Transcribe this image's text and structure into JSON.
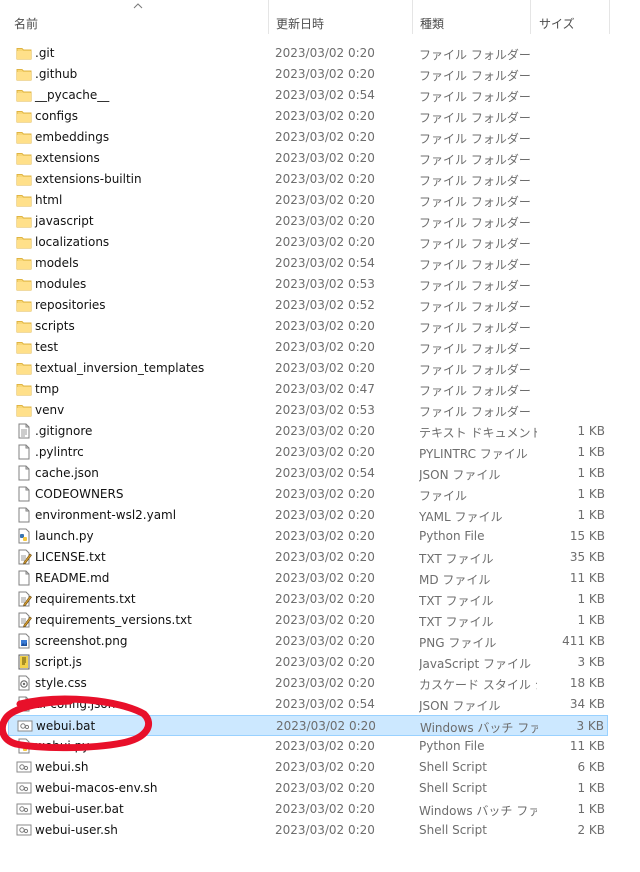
{
  "header": {
    "name": "名前",
    "modified": "更新日時",
    "type": "種類",
    "size": "サイズ"
  },
  "rows": [
    {
      "name": ".git",
      "date": "2023/03/02 0:20",
      "type": "ファイル フォルダー",
      "size": "",
      "icon": "folder-icon"
    },
    {
      "name": ".github",
      "date": "2023/03/02 0:20",
      "type": "ファイル フォルダー",
      "size": "",
      "icon": "folder-icon"
    },
    {
      "name": "__pycache__",
      "date": "2023/03/02 0:54",
      "type": "ファイル フォルダー",
      "size": "",
      "icon": "folder-icon"
    },
    {
      "name": "configs",
      "date": "2023/03/02 0:20",
      "type": "ファイル フォルダー",
      "size": "",
      "icon": "folder-icon"
    },
    {
      "name": "embeddings",
      "date": "2023/03/02 0:20",
      "type": "ファイル フォルダー",
      "size": "",
      "icon": "folder-icon"
    },
    {
      "name": "extensions",
      "date": "2023/03/02 0:20",
      "type": "ファイル フォルダー",
      "size": "",
      "icon": "folder-icon"
    },
    {
      "name": "extensions-builtin",
      "date": "2023/03/02 0:20",
      "type": "ファイル フォルダー",
      "size": "",
      "icon": "folder-icon"
    },
    {
      "name": "html",
      "date": "2023/03/02 0:20",
      "type": "ファイル フォルダー",
      "size": "",
      "icon": "folder-icon"
    },
    {
      "name": "javascript",
      "date": "2023/03/02 0:20",
      "type": "ファイル フォルダー",
      "size": "",
      "icon": "folder-icon"
    },
    {
      "name": "localizations",
      "date": "2023/03/02 0:20",
      "type": "ファイル フォルダー",
      "size": "",
      "icon": "folder-icon"
    },
    {
      "name": "models",
      "date": "2023/03/02 0:54",
      "type": "ファイル フォルダー",
      "size": "",
      "icon": "folder-icon"
    },
    {
      "name": "modules",
      "date": "2023/03/02 0:53",
      "type": "ファイル フォルダー",
      "size": "",
      "icon": "folder-icon"
    },
    {
      "name": "repositories",
      "date": "2023/03/02 0:52",
      "type": "ファイル フォルダー",
      "size": "",
      "icon": "folder-icon"
    },
    {
      "name": "scripts",
      "date": "2023/03/02 0:20",
      "type": "ファイル フォルダー",
      "size": "",
      "icon": "folder-icon"
    },
    {
      "name": "test",
      "date": "2023/03/02 0:20",
      "type": "ファイル フォルダー",
      "size": "",
      "icon": "folder-icon"
    },
    {
      "name": "textual_inversion_templates",
      "date": "2023/03/02 0:20",
      "type": "ファイル フォルダー",
      "size": "",
      "icon": "folder-icon"
    },
    {
      "name": "tmp",
      "date": "2023/03/02 0:47",
      "type": "ファイル フォルダー",
      "size": "",
      "icon": "folder-icon"
    },
    {
      "name": "venv",
      "date": "2023/03/02 0:53",
      "type": "ファイル フォルダー",
      "size": "",
      "icon": "folder-icon"
    },
    {
      "name": ".gitignore",
      "date": "2023/03/02 0:20",
      "type": "テキスト ドキュメント",
      "size": "1 KB",
      "icon": "text-document-icon"
    },
    {
      "name": ".pylintrc",
      "date": "2023/03/02 0:20",
      "type": "PYLINTRC ファイル",
      "size": "1 KB",
      "icon": "blank-file-icon"
    },
    {
      "name": "cache.json",
      "date": "2023/03/02 0:54",
      "type": "JSON ファイル",
      "size": "1 KB",
      "icon": "blank-file-icon"
    },
    {
      "name": "CODEOWNERS",
      "date": "2023/03/02 0:20",
      "type": "ファイル",
      "size": "1 KB",
      "icon": "blank-file-icon"
    },
    {
      "name": "environment-wsl2.yaml",
      "date": "2023/03/02 0:20",
      "type": "YAML ファイル",
      "size": "1 KB",
      "icon": "blank-file-icon"
    },
    {
      "name": "launch.py",
      "date": "2023/03/02 0:20",
      "type": "Python File",
      "size": "15 KB",
      "icon": "python-file-icon"
    },
    {
      "name": "LICENSE.txt",
      "date": "2023/03/02 0:20",
      "type": "TXT ファイル",
      "size": "35 KB",
      "icon": "text-edit-file-icon"
    },
    {
      "name": "README.md",
      "date": "2023/03/02 0:20",
      "type": "MD ファイル",
      "size": "11 KB",
      "icon": "blank-file-icon"
    },
    {
      "name": "requirements.txt",
      "date": "2023/03/02 0:20",
      "type": "TXT ファイル",
      "size": "1 KB",
      "icon": "text-edit-file-icon"
    },
    {
      "name": "requirements_versions.txt",
      "date": "2023/03/02 0:20",
      "type": "TXT ファイル",
      "size": "1 KB",
      "icon": "text-edit-file-icon"
    },
    {
      "name": "screenshot.png",
      "date": "2023/03/02 0:20",
      "type": "PNG ファイル",
      "size": "411 KB",
      "icon": "image-file-icon"
    },
    {
      "name": "script.js",
      "date": "2023/03/02 0:20",
      "type": "JavaScript ファイル",
      "size": "3 KB",
      "icon": "script-file-icon"
    },
    {
      "name": "style.css",
      "date": "2023/03/02 0:20",
      "type": "カスケード スタイル シ...",
      "size": "18 KB",
      "icon": "css-file-icon"
    },
    {
      "name": "ui-config.json",
      "date": "2023/03/02 0:54",
      "type": "JSON ファイル",
      "size": "34 KB",
      "icon": "blank-file-icon"
    },
    {
      "name": "webui.bat",
      "date": "2023/03/02 0:20",
      "type": "Windows バッチ ファ...",
      "size": "3 KB",
      "icon": "batch-file-icon",
      "selected": true
    },
    {
      "name": "webui.py",
      "date": "2023/03/02 0:20",
      "type": "Python File",
      "size": "11 KB",
      "icon": "python-file-icon"
    },
    {
      "name": "webui.sh",
      "date": "2023/03/02 0:20",
      "type": "Shell Script",
      "size": "6 KB",
      "icon": "shell-script-icon"
    },
    {
      "name": "webui-macos-env.sh",
      "date": "2023/03/02 0:20",
      "type": "Shell Script",
      "size": "1 KB",
      "icon": "shell-script-icon"
    },
    {
      "name": "webui-user.bat",
      "date": "2023/03/02 0:20",
      "type": "Windows バッチ ファ...",
      "size": "1 KB",
      "icon": "batch-file-icon"
    },
    {
      "name": "webui-user.sh",
      "date": "2023/03/02 0:20",
      "type": "Shell Script",
      "size": "2 KB",
      "icon": "shell-script-icon"
    }
  ],
  "annotation": {
    "color": "#e8102a",
    "target": "webui.bat"
  }
}
